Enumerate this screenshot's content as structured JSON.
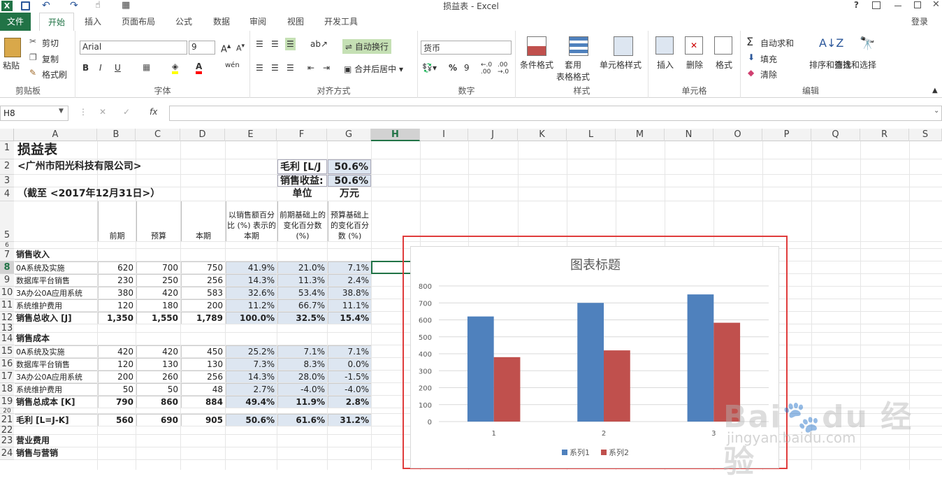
{
  "window": {
    "title": "损益表 - Excel",
    "help": "?",
    "login": "登录"
  },
  "tabs": [
    "文件",
    "开始",
    "插入",
    "页面布局",
    "公式",
    "数据",
    "审阅",
    "视图",
    "开发工具"
  ],
  "ribbon": {
    "clipboard": {
      "paste": "粘贴",
      "cut": "剪切",
      "copy": "复制",
      "format_painter": "格式刷",
      "label": "剪贴板"
    },
    "font": {
      "name": "Arial",
      "size": "9",
      "label": "字体",
      "bold": "B",
      "italic": "I",
      "underline": "U",
      "phonetic": "wén"
    },
    "align": {
      "wrap": "自动换行",
      "merge": "合并后居中",
      "label": "对齐方式"
    },
    "number": {
      "format": "货币",
      "percent": "%",
      "comma": "9",
      "label": "数字"
    },
    "styles": {
      "cond": "条件格式",
      "table": "套用\n表格格式",
      "cell": "单元格样式",
      "label": "样式"
    },
    "cells": {
      "insert": "插入",
      "delete": "删除",
      "format": "格式",
      "label": "单元格"
    },
    "editing": {
      "autosum": "自动求和",
      "fill": "填充",
      "clear": "清除",
      "sort": "排序和筛选",
      "find": "查找和选择",
      "label": "编辑"
    }
  },
  "namebox": "H8",
  "columns": [
    "A",
    "B",
    "C",
    "D",
    "E",
    "F",
    "G",
    "H",
    "I",
    "J",
    "K",
    "L",
    "M",
    "N",
    "O",
    "P",
    "Q",
    "R",
    "S"
  ],
  "rows": [
    "1",
    "2",
    "3",
    "4",
    "5",
    "6",
    "7",
    "8",
    "9",
    "10",
    "11",
    "12",
    "13",
    "14",
    "15",
    "16",
    "17",
    "18",
    "19",
    "20",
    "21",
    "22",
    "23",
    "24"
  ],
  "sheet": {
    "title": "损益表",
    "company": "<广州市阳光科技有限公司>",
    "date": "（截至 <2017年12月31日>）",
    "gross_label": "毛利 [L/J",
    "gross_val": "50.6%",
    "ret_label": "销售收益:",
    "ret_val": "50.6%",
    "unit": "单位",
    "unit_val": "万元",
    "hdr_b": "前期",
    "hdr_c": "预算",
    "hdr_d": "本期",
    "hdr_e": "以销售额百分比 (%) 表示的本期",
    "hdr_f": "前期基础上的变化百分数 (%)",
    "hdr_g": "预算基础上的变化百分数 (%)",
    "sec1": "销售收入",
    "rev_rows": [
      [
        "0A系统及实施",
        "620",
        "700",
        "750",
        "41.9%",
        "21.0%",
        "7.1%"
      ],
      [
        "数据库平台销售",
        "230",
        "250",
        "256",
        "14.3%",
        "11.3%",
        "2.4%"
      ],
      [
        "3A办公0A应用系统",
        "380",
        "420",
        "583",
        "32.6%",
        "53.4%",
        "38.8%"
      ],
      [
        "系统维护费用",
        "120",
        "180",
        "200",
        "11.2%",
        "66.7%",
        "11.1%"
      ],
      [
        "销售总收入 [J]",
        "1,350",
        "1,550",
        "1,789",
        "100.0%",
        "32.5%",
        "15.4%"
      ]
    ],
    "sec2": "销售成本",
    "cost_rows": [
      [
        "0A系统及实施",
        "420",
        "420",
        "450",
        "25.2%",
        "7.1%",
        "7.1%"
      ],
      [
        "数据库平台销售",
        "120",
        "130",
        "130",
        "7.3%",
        "8.3%",
        "0.0%"
      ],
      [
        "3A办公0A应用系统",
        "200",
        "260",
        "256",
        "14.3%",
        "28.0%",
        "-1.5%"
      ],
      [
        "系统维护费用",
        "50",
        "50",
        "48",
        "2.7%",
        "-4.0%",
        "-4.0%"
      ],
      [
        "销售总成本 [K]",
        "790",
        "860",
        "884",
        "49.4%",
        "11.9%",
        "2.8%"
      ]
    ],
    "gross_row": [
      "毛利 [L=J-K]",
      "560",
      "690",
      "905",
      "50.6%",
      "61.6%",
      "31.2%"
    ],
    "sec3": "营业费用",
    "sec3b": "销售与营销"
  },
  "chart_data": {
    "type": "bar",
    "title": "图表标题",
    "categories": [
      "1",
      "2",
      "3"
    ],
    "series": [
      {
        "name": "系列1",
        "values": [
          620,
          700,
          750
        ],
        "color": "#4f81bd"
      },
      {
        "name": "系列2",
        "values": [
          380,
          420,
          583
        ],
        "color": "#c0504d"
      }
    ],
    "ylim": [
      0,
      800
    ],
    "yticks": [
      "0",
      "100",
      "200",
      "300",
      "400",
      "500",
      "600",
      "700",
      "800"
    ],
    "legend": "bottom",
    "grid": true
  }
}
